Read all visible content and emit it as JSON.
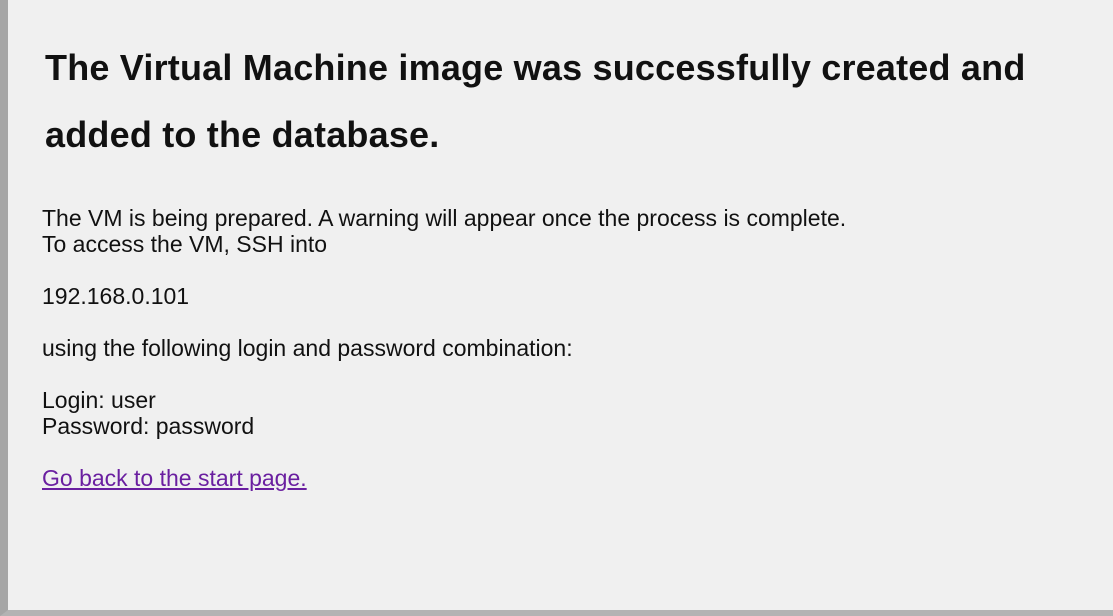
{
  "message": {
    "title": "The Virtual Machine image was successfully created and added to the database.",
    "line_prepared": "The VM is being prepared. A warning will appear once the process is complete.",
    "line_access": "To access the VM, SSH into",
    "ip_address": "192.168.0.101",
    "line_combination": "using the following login and password combination:",
    "login": "Login: user",
    "password": "Password: password",
    "back_link": "Go back to the start page."
  },
  "colors": {
    "panel_background": "#f0f0f0",
    "left_border": "#a6a6a6",
    "link": "#6a1fa0",
    "text": "#111111"
  }
}
